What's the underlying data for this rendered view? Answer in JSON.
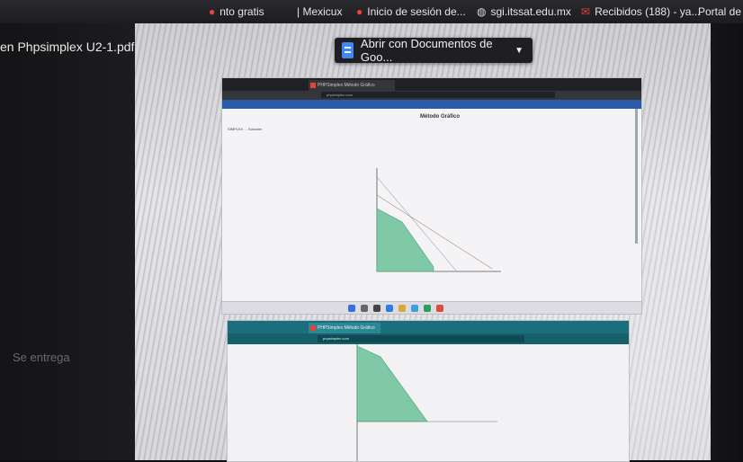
{
  "bookmarks": {
    "item1": "nto gratis",
    "item2": "| Mexicux",
    "item3": "Inicio de sesión de...",
    "item4": "sgi.itssat.edu.mx",
    "item5": "Recibidos (188) - ya...",
    "item6": "Portal de"
  },
  "viewer": {
    "filename": "en Phpsimplex U2-1.pdf",
    "open_with_label": "Abrir con Documentos de Goo...",
    "footer_text": "Se entrega"
  },
  "shot1": {
    "tab_label": "PHPSimplex Método Gráfico",
    "url": "phpsimplex.com",
    "heading": "Método Gráfico",
    "sidebar": "SIMPLEX ... Solución"
  },
  "shot2": {
    "tab_label": "PHPSimplex Método Gráfico",
    "url": "phpsimplex.com"
  },
  "colors": {
    "feasible_region": "#7fc9a6",
    "site_bar": "#2a5caa",
    "shot2_titlebar": "#1b6f7d"
  }
}
